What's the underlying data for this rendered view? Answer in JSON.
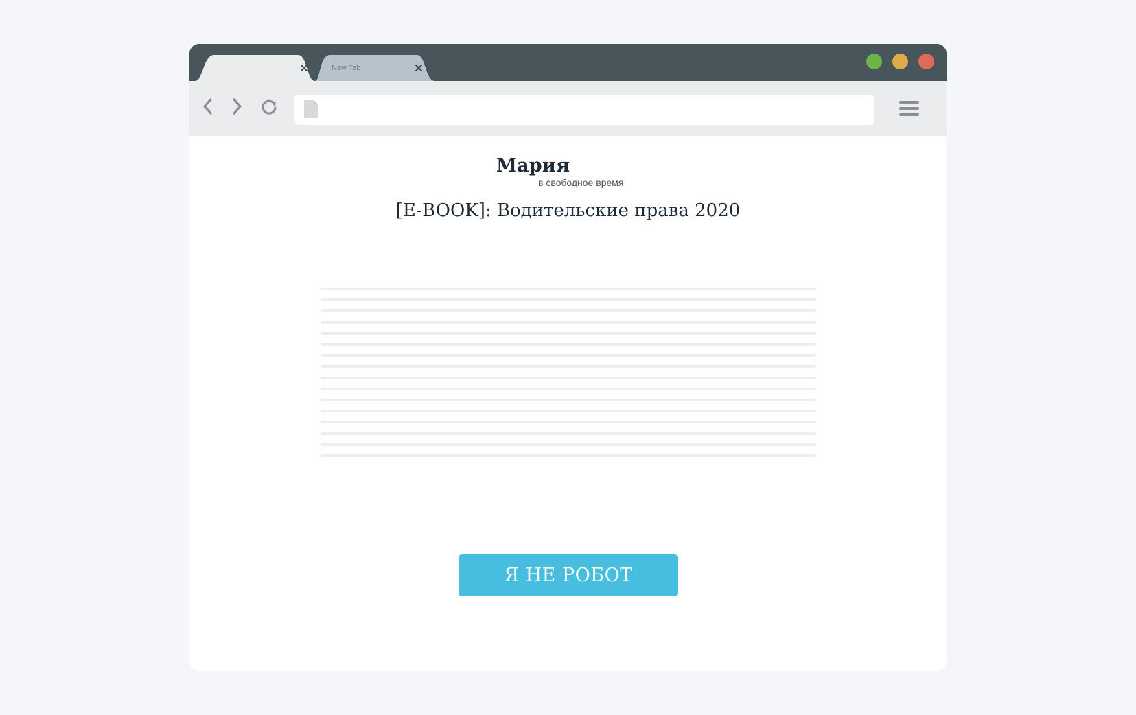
{
  "browser": {
    "tabs": [
      {
        "title": "",
        "active": true,
        "close_icon": "close-icon"
      },
      {
        "title": "New Tab",
        "active": false,
        "close_icon": "close-icon"
      }
    ],
    "window_controls": {
      "green": "#6db346",
      "yellow": "#e0ab4a",
      "red": "#de6b5a"
    },
    "toolbar": {
      "icons": [
        "chevron-left-icon",
        "chevron-right-icon",
        "reload-icon",
        "page-icon",
        "hamburger-menu-icon"
      ],
      "address": ""
    }
  },
  "page": {
    "brand_name": "Мария",
    "brand_tagline": "в свободное время",
    "title": "[E-BOOK]: Водительские права 2020",
    "placeholder_line_count": 16,
    "button_label": "Я НЕ РОБОТ",
    "button_color": "#47bde0"
  }
}
